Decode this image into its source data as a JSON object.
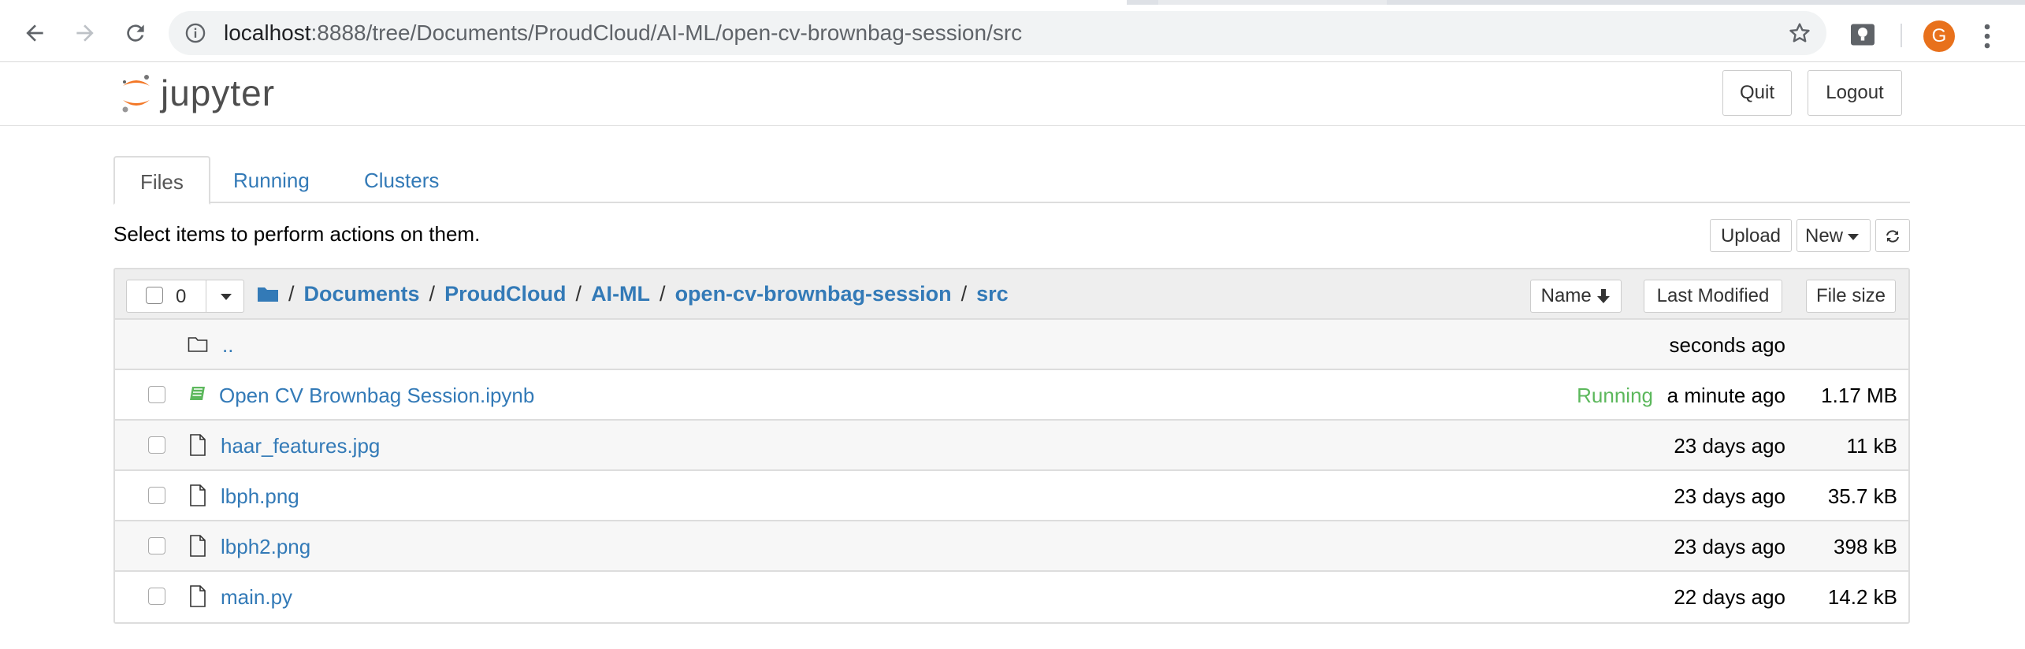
{
  "browser": {
    "url_host": "localhost",
    "url_rest": ":8888/tree/Documents/ProudCloud/AI-ML/open-cv-brownbag-session/src",
    "icons": [
      "back-arrow-icon",
      "forward-arrow-icon",
      "reload-icon",
      "info-icon",
      "star-icon",
      "extension-icon",
      "kebab-menu-icon"
    ],
    "avatar_letter": "G",
    "avatar_color": "#e8711c"
  },
  "header": {
    "logo_text": "jupyter",
    "quit_label": "Quit",
    "logout_label": "Logout"
  },
  "tabs": [
    {
      "label": "Files",
      "active": true
    },
    {
      "label": "Running",
      "active": false
    },
    {
      "label": "Clusters",
      "active": false
    }
  ],
  "toolbar": {
    "hint": "Select items to perform actions on them.",
    "upload_label": "Upload",
    "new_label": "New"
  },
  "list_header": {
    "selected_count": "0",
    "breadcrumb": [
      "Documents",
      "ProudCloud",
      "AI-ML",
      "open-cv-brownbag-session",
      "src"
    ],
    "sort_name": "Name",
    "sort_modified": "Last Modified",
    "sort_size": "File size"
  },
  "files": [
    {
      "name": "..",
      "icon": "folder-icon",
      "status": "",
      "modified": "seconds ago",
      "size": ""
    },
    {
      "name": "Open CV Brownbag Session.ipynb",
      "icon": "notebook-icon",
      "status": "Running",
      "modified": "a minute ago",
      "size": "1.17 MB"
    },
    {
      "name": "haar_features.jpg",
      "icon": "file-icon",
      "status": "",
      "modified": "23 days ago",
      "size": "11 kB"
    },
    {
      "name": "lbph.png",
      "icon": "file-icon",
      "status": "",
      "modified": "23 days ago",
      "size": "35.7 kB"
    },
    {
      "name": "lbph2.png",
      "icon": "file-icon",
      "status": "",
      "modified": "23 days ago",
      "size": "398 kB"
    },
    {
      "name": "main.py",
      "icon": "file-icon",
      "status": "",
      "modified": "22 days ago",
      "size": "14.2 kB"
    }
  ],
  "colors": {
    "link": "#337ab7",
    "running": "#5cb85c",
    "jupyter_orange": "#f37726"
  }
}
